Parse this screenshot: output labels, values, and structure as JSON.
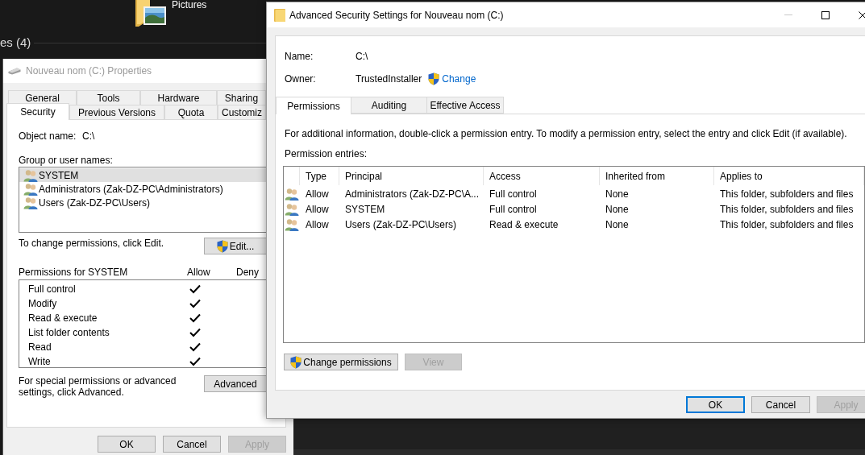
{
  "desktop": {
    "folder_label": "Pictures",
    "group_header": "es (4)"
  },
  "properties_dialog": {
    "title": "Nouveau nom (C:) Properties",
    "tab_rows": [
      [
        {
          "label": "General",
          "selected": false
        },
        {
          "label": "Tools",
          "selected": false
        },
        {
          "label": "Hardware",
          "selected": false
        },
        {
          "label": "Sharing",
          "selected": false
        }
      ],
      [
        {
          "label": "Security",
          "selected": true
        },
        {
          "label": "Previous Versions",
          "selected": false
        },
        {
          "label": "Quota",
          "selected": false
        },
        {
          "label": "Customiz",
          "selected": false
        }
      ]
    ],
    "object_name_label": "Object name:",
    "object_name": "C:\\",
    "groups_label": "Group or user names:",
    "groups": [
      {
        "name": "SYSTEM",
        "selected": true
      },
      {
        "name": "Administrators (Zak-DZ-PC\\Administrators)",
        "selected": false
      },
      {
        "name": "Users (Zak-DZ-PC\\Users)",
        "selected": false
      }
    ],
    "edit_hint": "To change permissions, click Edit.",
    "edit_button": "Edit...",
    "permissions_label": "Permissions for SYSTEM",
    "permission_columns": [
      "Allow",
      "Deny"
    ],
    "permissions": [
      {
        "name": "Full control",
        "allow": true
      },
      {
        "name": "Modify",
        "allow": true
      },
      {
        "name": "Read & execute",
        "allow": true
      },
      {
        "name": "List folder contents",
        "allow": true
      },
      {
        "name": "Read",
        "allow": true
      },
      {
        "name": "Write",
        "allow": true
      }
    ],
    "advanced_hint": "For special permissions or advanced settings, click Advanced.",
    "advanced_button": "Advanced",
    "buttons": [
      {
        "label": "OK",
        "disabled": false
      },
      {
        "label": "Cancel",
        "disabled": false
      },
      {
        "label": "Apply",
        "disabled": true
      }
    ]
  },
  "advanced_dialog": {
    "title": "Advanced Security Settings for Nouveau nom (C:)",
    "name_label": "Name:",
    "name": "C:\\",
    "owner_label": "Owner:",
    "owner": "TrustedInstaller",
    "change_link": "Change",
    "tabs": [
      {
        "label": "Permissions",
        "selected": true
      },
      {
        "label": "Auditing",
        "selected": false
      },
      {
        "label": "Effective Access",
        "selected": false
      }
    ],
    "info": "For additional information, double-click a permission entry. To modify a permission entry, select the entry and click Edit (if available).",
    "entries_label": "Permission entries:",
    "table": {
      "columns": [
        "Type",
        "Principal",
        "Access",
        "Inherited from",
        "Applies to"
      ],
      "rows": [
        {
          "type": "Allow",
          "principal": "Administrators (Zak-DZ-PC\\A...",
          "access": "Full control",
          "inherited_from": "None",
          "applies_to": "This folder, subfolders and files"
        },
        {
          "type": "Allow",
          "principal": "SYSTEM",
          "access": "Full control",
          "inherited_from": "None",
          "applies_to": "This folder, subfolders and files"
        },
        {
          "type": "Allow",
          "principal": "Users (Zak-DZ-PC\\Users)",
          "access": "Read & execute",
          "inherited_from": "None",
          "applies_to": "This folder, subfolders and files"
        }
      ]
    },
    "actions": [
      {
        "label": "Change permissions",
        "kind": "elevated",
        "disabled": false
      },
      {
        "label": "View",
        "kind": "plain",
        "disabled": true
      }
    ],
    "buttons": [
      {
        "label": "OK",
        "disabled": false,
        "default": true
      },
      {
        "label": "Cancel",
        "disabled": false,
        "default": false
      },
      {
        "label": "Apply",
        "disabled": true,
        "default": false
      }
    ]
  }
}
